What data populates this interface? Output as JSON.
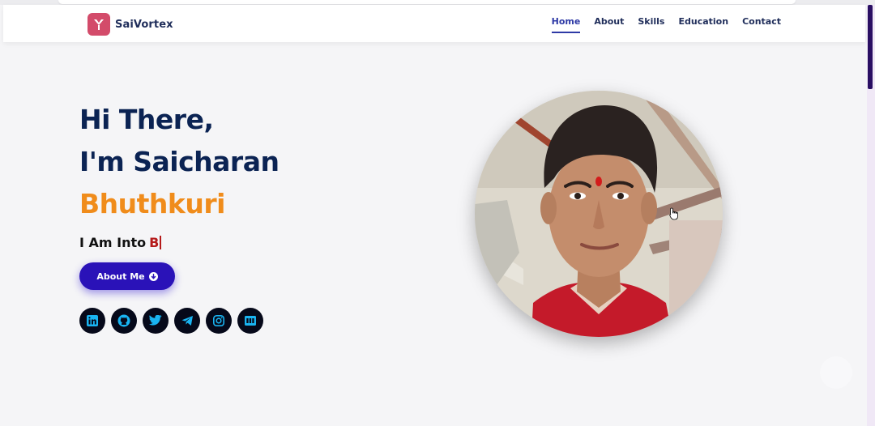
{
  "brand": {
    "name": "SaiVortex",
    "logo_icon": "bird-logo-icon",
    "logo_color": "#d34b6a"
  },
  "nav": {
    "items": [
      {
        "label": "Home",
        "active": true
      },
      {
        "label": "About",
        "active": false
      },
      {
        "label": "Skills",
        "active": false
      },
      {
        "label": "Education",
        "active": false
      },
      {
        "label": "Contact",
        "active": false
      }
    ]
  },
  "hero": {
    "line1": "Hi There,",
    "line2": "I'm Saicharan",
    "name": "Bhuthkuri",
    "typed_prefix": "I Am Into",
    "typed_word": "B",
    "button_label": "About Me",
    "button_icon": "arrow-circle-down-icon"
  },
  "socials": [
    {
      "icon": "linkedin-icon"
    },
    {
      "icon": "github-icon"
    },
    {
      "icon": "twitter-icon"
    },
    {
      "icon": "telegram-icon"
    },
    {
      "icon": "instagram-icon"
    },
    {
      "icon": "dev-icon"
    }
  ],
  "colors": {
    "heading": "#0b2353",
    "name_accent": "#f08c1b",
    "typed_accent": "#b51a1a",
    "button": "#2a12b8",
    "nav_active": "#2e3aa6",
    "social_bg": "#06091a",
    "social_icon": "#19b4f2"
  }
}
